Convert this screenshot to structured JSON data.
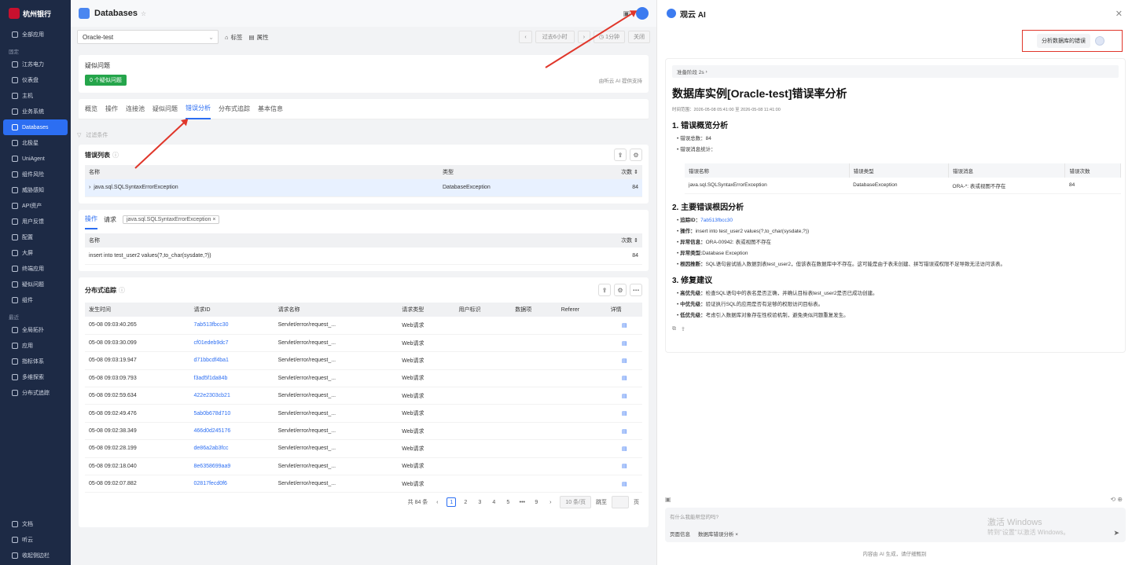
{
  "sidebar": {
    "logo": "杭州银行",
    "all_apps": "全部应用",
    "group_fixed": "固定",
    "items": [
      "江苏电力",
      "仪表盘",
      "主机",
      "业务系统",
      "Databases",
      "北极星",
      "UniAgent",
      "组件风险",
      "威胁感知",
      "API资产",
      "用户反馈",
      "配置",
      "大屏",
      "终端应用",
      "疑似问题",
      "组件"
    ],
    "active_index": 4,
    "group_recent": "最近",
    "recent": [
      "全局拓扑",
      "应用",
      "指标体系",
      "多维探索",
      "分布式追踪"
    ],
    "bottom": [
      "文档",
      "听云",
      "收起侧边栏"
    ]
  },
  "header": {
    "title": "Databases"
  },
  "filter": {
    "instance": "Oracle-test",
    "tag_label": "标签",
    "attr_label": "属性",
    "time_range": "过去6小时",
    "interval": "1分钟",
    "refresh": "关闭"
  },
  "question": {
    "title": "疑似问题",
    "badge": "0 个疑似问题",
    "provider": "由听云 AI 提供支持"
  },
  "tabs": [
    "概览",
    "操作",
    "连接池",
    "疑似问题",
    "错误分析",
    "分布式追踪",
    "基本信息"
  ],
  "active_tab": 4,
  "filter_placeholder": "过滤条件",
  "error_list": {
    "title": "错误列表",
    "headers": [
      "名称",
      "类型",
      "次数"
    ],
    "rows": [
      {
        "name": "java.sql.SQLSyntaxErrorException",
        "type": "DatabaseException",
        "count": "84"
      }
    ]
  },
  "ops": {
    "tab_ops": "操作",
    "tab_req": "请求",
    "tag": "java.sql.SQLSyntaxErrorException",
    "headers": [
      "名称",
      "次数"
    ],
    "rows": [
      {
        "name": "insert into test_user2 values(?,to_char(sysdate,?))",
        "count": "84"
      }
    ]
  },
  "trace": {
    "title": "分布式追踪",
    "headers": [
      "发生时间",
      "请求ID",
      "请求名称",
      "请求类型",
      "用户标识",
      "数据项",
      "Referer",
      "详情"
    ],
    "rows": [
      {
        "time": "05-08 09:03:40.265",
        "id": "7ab513fbcc30",
        "name": "Servlet/error/request_...",
        "type": "Web请求"
      },
      {
        "time": "05-08 09:03:30.099",
        "id": "cf01edeb9dc7",
        "name": "Servlet/error/request_...",
        "type": "Web请求"
      },
      {
        "time": "05-08 09:03:19.947",
        "id": "d71bbcdf4ba1",
        "name": "Servlet/error/request_...",
        "type": "Web请求"
      },
      {
        "time": "05-08 09:03:09.793",
        "id": "f3ad5f1da84b",
        "name": "Servlet/error/request_...",
        "type": "Web请求"
      },
      {
        "time": "05-08 09:02:59.634",
        "id": "422e2303cb21",
        "name": "Servlet/error/request_...",
        "type": "Web请求"
      },
      {
        "time": "05-08 09:02:49.476",
        "id": "5ab0b678d710",
        "name": "Servlet/error/request_...",
        "type": "Web请求"
      },
      {
        "time": "05-08 09:02:38.349",
        "id": "466d0d245176",
        "name": "Servlet/error/request_...",
        "type": "Web请求"
      },
      {
        "time": "05-08 09:02:28.199",
        "id": "de86a2ab3fcc",
        "name": "Servlet/error/request_...",
        "type": "Web请求"
      },
      {
        "time": "05-08 09:02:18.040",
        "id": "8e6358699aa9",
        "name": "Servlet/error/request_...",
        "type": "Web请求"
      },
      {
        "time": "05-08 09:02:07.882",
        "id": "02817fecd0f6",
        "name": "Servlet/error/request_...",
        "type": "Web请求"
      }
    ],
    "pager": {
      "total": "共 84 条",
      "pages": [
        "1",
        "2",
        "3",
        "4",
        "5",
        "•••",
        "9"
      ],
      "current": "1",
      "size": "10 条/页",
      "goto": "跳至",
      "page_unit": "页"
    }
  },
  "ai": {
    "title": "观云 AI",
    "user_message": "分析数据库的错误",
    "stage": "准备阶段 2s",
    "report_title": "数据库实例[Oracle-test]错误率分析",
    "time_range": "时间范围：2026-05-08 05:41:00 至 2026-05-08 11:41:00",
    "s1": "1. 错误概览分析",
    "s1_items": [
      "错误总数：84",
      "错误消息统计："
    ],
    "table_headers": [
      "错误名称",
      "错误类型",
      "错误消息",
      "错误次数"
    ],
    "table_row": [
      "java.sql.SQLSyntaxErrorException",
      "DatabaseException",
      "ORA-*: 表或视图不存在",
      "84"
    ],
    "s2": "2. 主要错误根因分析",
    "s2_items": [
      {
        "k": "追踪ID：",
        "v": "7ab513fbcc30"
      },
      {
        "k": "操作：",
        "v": "insert into test_user2 values(?,to_char(sysdate,?))"
      },
      {
        "k": "异常信息：",
        "v": "ORA-00942: 表或视图不存在"
      },
      {
        "k": "异常类型:",
        "v": "Database Exception"
      },
      {
        "k": "根因推断：",
        "v": "SQL语句尝试插入数据到表test_user2，但该表在数据库中不存在。这可能是由于表未创建、拼写错误或权限不足导致无法访问该表。"
      }
    ],
    "s3": "3. 修复建议",
    "s3_items": [
      {
        "k": "高优先级：",
        "v": "检查SQL语句中的表名是否正确，并确认目标表test_user2是否已成功创建。"
      },
      {
        "k": "中优先级：",
        "v": "验证执行SQL的应用是否有足够的权限访问目标表。"
      },
      {
        "k": "低优先级：",
        "v": "考虑引入数据库对象存在性校验机制，避免类似问题重复发生。"
      }
    ],
    "input_placeholder": "有什么我能帮您的吗?",
    "ctx1": "页面信息",
    "ctx2": "数据库错误分析",
    "win1": "激活 Windows",
    "win2": "转到\"设置\"以激活 Windows。",
    "footer": "内容由 AI 生成，请仔细甄别"
  },
  "colors": {
    "accent": "#2c6ef2",
    "sidebar": "#1d2a45",
    "annotation": "#e0362a"
  }
}
